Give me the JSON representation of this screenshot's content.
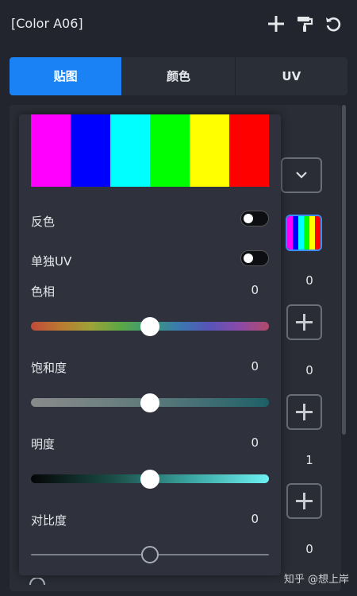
{
  "title": "[Color A06]",
  "toolbar": {
    "add_icon": "plus-icon",
    "paint_icon": "paint-roller-icon",
    "reset_icon": "refresh-icon"
  },
  "tabs": [
    {
      "label": "贴图",
      "active": true
    },
    {
      "label": "颜色",
      "active": false
    },
    {
      "label": "UV",
      "active": false
    }
  ],
  "side": {
    "values": [
      "0",
      "0",
      "1",
      "0"
    ]
  },
  "popup": {
    "swatch_colors": [
      "#ff00ff",
      "#0000ff",
      "#00ffff",
      "#00ff00",
      "#ffff00",
      "#ff0000"
    ],
    "invert": {
      "label": "反色",
      "on": false
    },
    "separate_uv": {
      "label": "单独UV",
      "on": false
    },
    "hue": {
      "label": "色相",
      "value": "0",
      "level": 0.5
    },
    "saturation": {
      "label": "饱和度",
      "value": "0",
      "level": 0.5
    },
    "brightness": {
      "label": "明度",
      "value": "0",
      "level": 0.5
    },
    "contrast": {
      "label": "对比度",
      "value": "0",
      "level": 0.5
    }
  },
  "watermark": "知乎 @想上岸"
}
